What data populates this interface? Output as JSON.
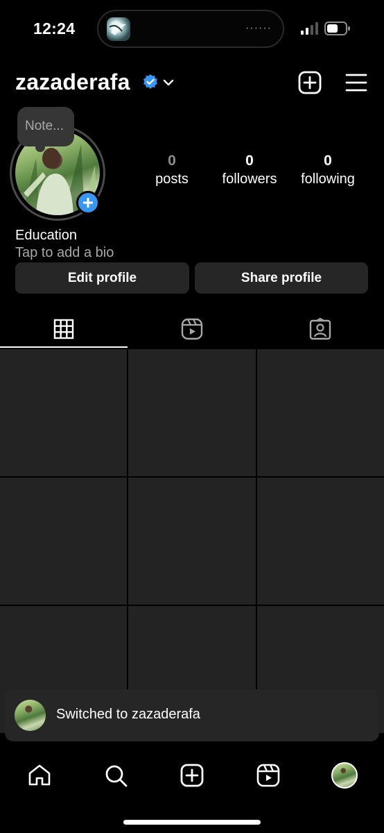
{
  "status_bar": {
    "time": "12:24",
    "island_dots": "······",
    "icons": [
      "signal-icon",
      "battery-icon"
    ]
  },
  "header": {
    "username": "zazaderafa",
    "icons": [
      "verified-badge-icon",
      "chevron-down-icon",
      "new-post-icon",
      "menu-icon"
    ]
  },
  "profile": {
    "note_placeholder": "Note...",
    "stats": {
      "posts_count": "0",
      "posts_label": "posts",
      "followers_count": "0",
      "followers_label": "followers",
      "following_count": "0",
      "following_label": "following"
    },
    "category": "Education",
    "bio_placeholder": "Tap to add a bio",
    "edit_button": "Edit profile",
    "share_button": "Share profile"
  },
  "tabs": {
    "items": [
      "grid-icon",
      "reels-icon",
      "tagged-icon"
    ],
    "selected": "grid-icon"
  },
  "toast": {
    "message": "Switched to zazaderafa"
  },
  "bottom_nav": {
    "items": [
      "home-icon",
      "search-icon",
      "create-icon",
      "reels-icon",
      "profile-avatar"
    ]
  },
  "colors": {
    "background": "#000000",
    "surface": "#262626",
    "grid_cell": "#232323",
    "accent_blue": "#3897f0",
    "muted_text": "#a8a8a8"
  }
}
